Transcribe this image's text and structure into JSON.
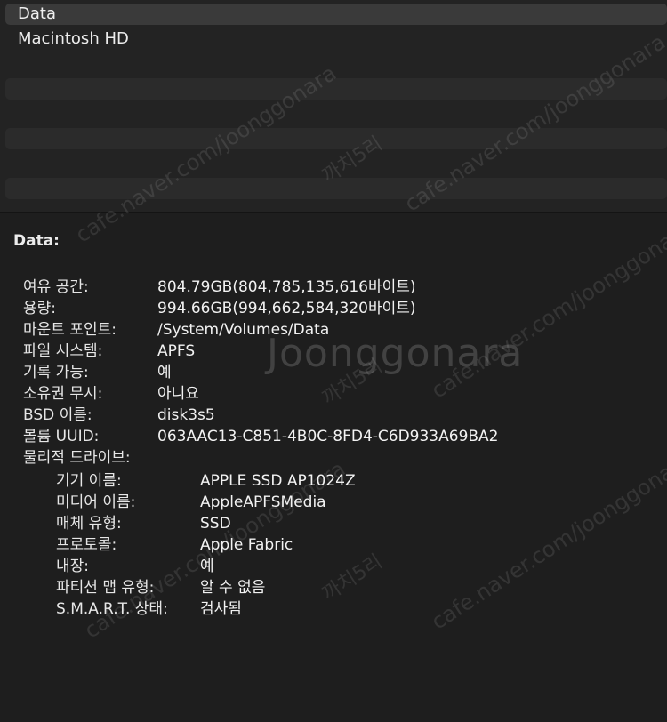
{
  "volume_list": {
    "items": [
      "Data",
      "Macintosh HD"
    ],
    "selected": "Data"
  },
  "detail": {
    "title": "Data:",
    "properties": [
      {
        "key": "여유 공간:",
        "value": "804.79GB(804,785,135,616바이트)"
      },
      {
        "key": "용량:",
        "value": "994.66GB(994,662,584,320바이트)"
      },
      {
        "key": "마운트 포인트:",
        "value": "/System/Volumes/Data"
      },
      {
        "key": "파일 시스템:",
        "value": "APFS"
      },
      {
        "key": "기록 가능:",
        "value": "예"
      },
      {
        "key": "소유권 무시:",
        "value": "아니요"
      },
      {
        "key": "BSD 이름:",
        "value": "disk3s5"
      },
      {
        "key": "볼륨 UUID:",
        "value": "063AAC13-C851-4B0C-8FD4-C6D933A69BA2"
      },
      {
        "key": "물리적 드라이브:",
        "value": ""
      }
    ],
    "physical_drive": [
      {
        "key": "기기 이름:",
        "value": "APPLE SSD AP1024Z"
      },
      {
        "key": "미디어 이름:",
        "value": "AppleAPFSMedia"
      },
      {
        "key": "매체 유형:",
        "value": "SSD"
      },
      {
        "key": "프로토콜:",
        "value": "Apple Fabric"
      },
      {
        "key": "내장:",
        "value": "예"
      },
      {
        "key": "파티션 맵 유형:",
        "value": "알 수 없음"
      },
      {
        "key": "S.M.A.R.T. 상태:",
        "value": "검사됨"
      }
    ]
  },
  "watermark": {
    "logo": "Joonggonara",
    "url": "cafe.naver.com/joonggonara",
    "tag": "까치5리"
  },
  "colors": {
    "background": "#1e1e1e",
    "selected_row": "#3a3a3a",
    "stripe_row": "#2b2b2b",
    "text": "#ececec"
  }
}
